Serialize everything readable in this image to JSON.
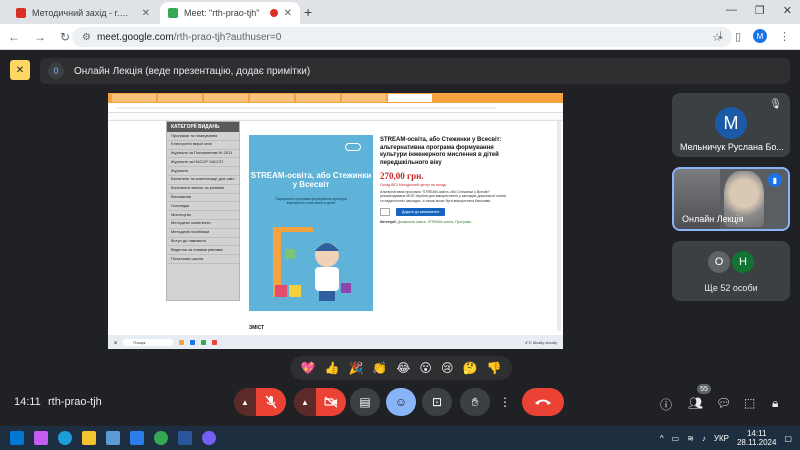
{
  "browser": {
    "tabs": [
      {
        "title": "Методичний захід - r.melnych",
        "favicon_color": "#d93025"
      },
      {
        "title": "Meet: \"rth-prao-tjh\"",
        "favicon_color": "#34a853",
        "recording": true
      }
    ],
    "new_tab_label": "+",
    "url_host": "meet.google.com",
    "url_path": "/rth-prao-tjh?authuser=0",
    "profile_initial": "M"
  },
  "meet": {
    "presentation_icon": "present-icon",
    "banner_count": "0",
    "banner_text": "Онлайн Лекція (веде презентацію, додає примітки)",
    "meeting_time": "14:11",
    "meeting_code": "rth-prao-tjh",
    "participants_badge": "55",
    "reactions": [
      "💖",
      "👍",
      "🎉",
      "👏",
      "😂",
      "😮",
      "😢",
      "🤔",
      "👎"
    ]
  },
  "participants": [
    {
      "initial": "M",
      "name": "Мельничук Руслана Бо...",
      "avatar_color": "#1a5aa6",
      "muted": true
    },
    {
      "name": "Онлайн Лекція",
      "speaking": true
    },
    {
      "initials": [
        "О",
        "Н"
      ],
      "avatar_colors": [
        "#5f6368",
        "#137333"
      ],
      "more_text": "Ще 52 особи"
    }
  ],
  "shared_screen": {
    "sidebar_title": "КАТЕГОРІЇ ВИДАНЬ",
    "sidebar_items": [
      "Програми та планування",
      "Електронні версії книг",
      "Журнали за Поновленим НІ 2011",
      "Журнали за НАССР ХАССП",
      "Журнали",
      "Бюлетень та компенсації для шкіл",
      "Конспекти занять за різними",
      "Виховання",
      "Логопедія",
      "Мистецтво",
      "Методичні комплекти",
      "Методичні посібники",
      "Вступ до навчання",
      "Ведення за новими рівнями",
      "Початкова школа"
    ],
    "cover_title": "STREAM-освіта, або Стежинки у Всесвіт",
    "cover_subtitle": "Парціальна програма формування культури інженерного мислення в дітей",
    "product_title": "STREAM-освіта, або Стежинки у Всесвіт: альтернативна програма формування культури інженерного мислення в дітей передшкільного віку",
    "price": "270,00 грн.",
    "availability": "Склад ВЕЗ Методичний центр/ на складі",
    "description": "Альтернативна програма \"STREAM-освіта, або Стежинки у Всесвіт\" рекомендована МОН України для використання у закладах дошкільної освіти та педагогічних закладах, а також може бути використана батьками.",
    "add_to_cart": "Додати до замовлення",
    "qty": "1",
    "category_label": "Категорії:",
    "categories": "Дошкільна освіта, STREAM-освіта, Програми",
    "contents_heading": "ЗМІСТ",
    "taskbar_search": "Пошук",
    "weather": "4°C Mostly cloudy"
  },
  "taskbar": {
    "time": "14:11",
    "date": "28.11.2024",
    "lang": "УКР"
  }
}
